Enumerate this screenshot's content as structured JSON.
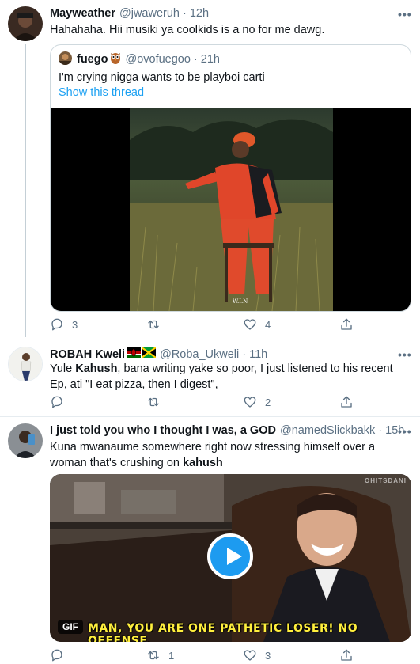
{
  "tweets": [
    {
      "name": "Mayweather",
      "handle": "@jwaweruh",
      "sep": "·",
      "time": "12h",
      "text": "Hahahaha. Hii musiki ya coolkids is a no for me dawg.",
      "quote": {
        "name": "fuego",
        "handle": "@ovofuegoo",
        "sep": "·",
        "time": "21h",
        "text": "I'm crying nigga wants to be playboi carti",
        "show_thread": "Show this thread",
        "album_label": "W.I.N"
      },
      "actions": {
        "reply": "3",
        "retweet": "",
        "like": "4"
      }
    },
    {
      "name": "ROBAH Kweli",
      "flags": [
        "kenya-flag",
        "jamaica-flag"
      ],
      "handle": "@Roba_Ukweli",
      "sep": "·",
      "time": "11h",
      "text_before": "Yule ",
      "text_bold": "Kahush",
      "text_after": ", bana writing yake so poor, I just listened to his recent Ep, ati \"I eat pizza, then I digest\",",
      "actions": {
        "reply": "",
        "retweet": "",
        "like": "2"
      }
    },
    {
      "name": "I just told you who I thought I was, a GOD",
      "handle": "@namedSlickbakk",
      "sep": "·",
      "time": "15h",
      "text_before": "Kuna mwanaume somewhere right now stressing himself over a woman that's crushing on ",
      "text_bold": "kahush",
      "gif_badge": "GIF",
      "gif_caption": "MAN, YOU ARE ONE PATHETIC LOSER! NO OFFENSE.",
      "watermark": "OHITSDANI",
      "actions": {
        "reply": "",
        "retweet": "1",
        "like": "3"
      }
    }
  ],
  "more_icon": "•••",
  "colors": {
    "link": "#1da1f2",
    "muted": "#5b7083",
    "border": "#e6ecf0"
  }
}
